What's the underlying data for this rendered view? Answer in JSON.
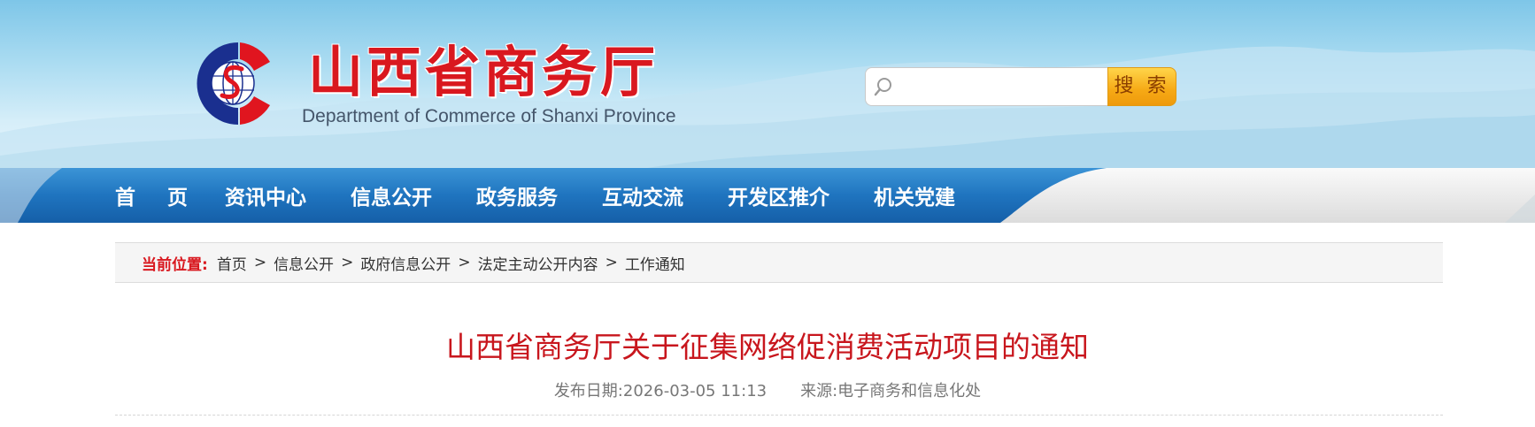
{
  "header": {
    "title": "山西省商务厅",
    "subtitle": "Department of Commerce of Shanxi Province",
    "logo_icon": "department-logo-icon"
  },
  "search": {
    "placeholder": "",
    "value": "",
    "button_label": "搜 索",
    "icon": "search-icon",
    "button_color": "#f6a915"
  },
  "nav": {
    "items": [
      {
        "label": "首 页"
      },
      {
        "label": "资讯中心"
      },
      {
        "label": "信息公开"
      },
      {
        "label": "政务服务"
      },
      {
        "label": "互动交流"
      },
      {
        "label": "开发区推介"
      },
      {
        "label": "机关党建"
      }
    ],
    "color": "#1f6fb8"
  },
  "breadcrumb": {
    "label": "当前位置:",
    "separator": ">",
    "items": [
      "首页",
      "信息公开",
      "政府信息公开",
      "法定主动公开内容",
      "工作通知"
    ]
  },
  "article": {
    "title": "山西省商务厅关于征集网络促消费活动项目的通知",
    "date_label": "发布日期:",
    "date": "2026-03-05 11:13",
    "source_label": "来源:",
    "source": "电子商务和信息化处",
    "title_color": "#c8161d"
  },
  "colors": {
    "brand_red": "#d9181f",
    "nav_blue": "#1f6fb8",
    "sky_light": "#d6eef9"
  }
}
